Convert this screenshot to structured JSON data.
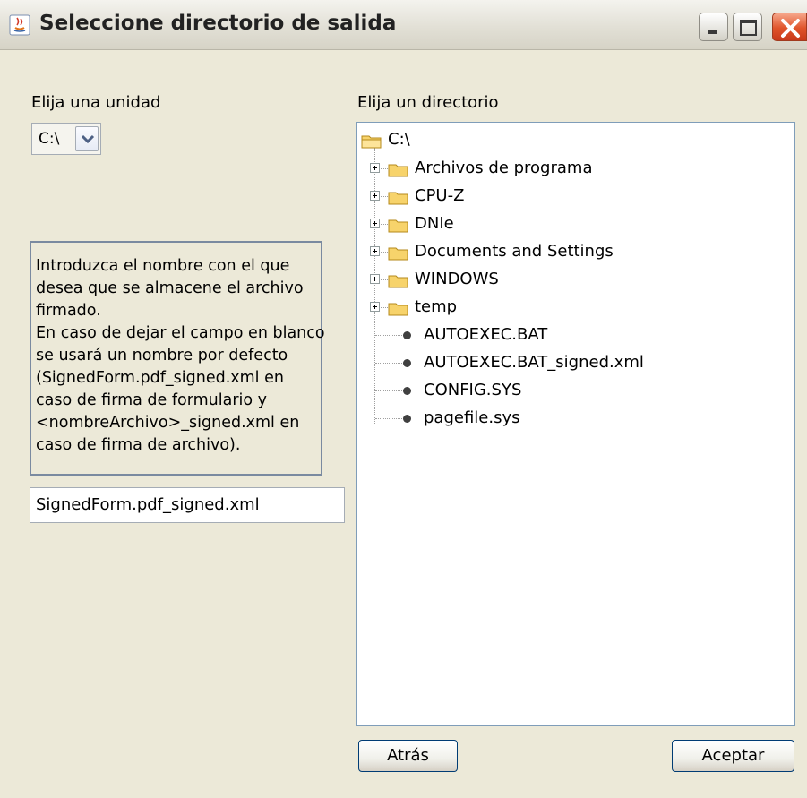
{
  "window": {
    "title": "Seleccione directorio de salida",
    "controls": {
      "minimize_icon": "minimize-icon",
      "maximize_icon": "maximize-icon",
      "close_icon": "close-icon"
    }
  },
  "drive": {
    "label": "Elija una unidad",
    "selected": "C:\\"
  },
  "info": {
    "lines": [
      "Introduzca el nombre con el que",
      "desea que se almacene el archivo",
      "firmado.",
      "En caso de dejar el campo en blanco",
      "se usará un nombre por defecto",
      "(SignedForm.pdf_signed.xml en",
      "caso de firma de formulario y",
      "<nombreArchivo>_signed.xml en",
      "caso de firma de archivo)."
    ]
  },
  "filename": {
    "value": "SignedForm.pdf_signed.xml"
  },
  "directory": {
    "label": "Elija un directorio",
    "root": "C:\\",
    "folders": [
      "Archivos de programa",
      "CPU-Z",
      "DNIe",
      "Documents and Settings",
      "WINDOWS",
      "temp"
    ],
    "files": [
      "AUTOEXEC.BAT",
      "AUTOEXEC.BAT_signed.xml",
      "CONFIG.SYS",
      "pagefile.sys"
    ]
  },
  "buttons": {
    "back": "Atrás",
    "accept": "Aceptar"
  },
  "colors": {
    "folder": "#f7d36b",
    "close_button": "#e0542a",
    "tree_border": "#7f9db9"
  }
}
